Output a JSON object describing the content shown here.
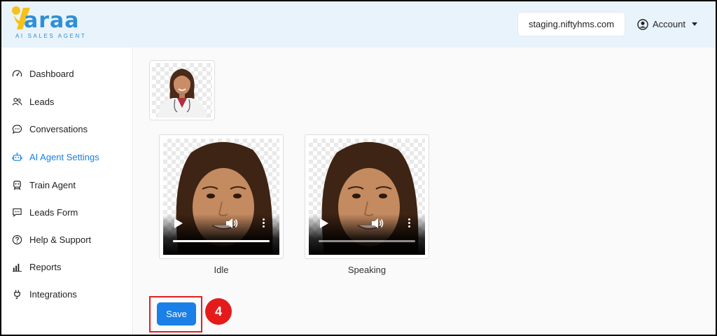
{
  "brand": {
    "name": "Yaraa",
    "word": "araa",
    "tagline": "AI SALES AGENT",
    "colors": {
      "blue": "#2e8fd6",
      "yellow": "#f6c21a"
    }
  },
  "header": {
    "domain": "staging.niftyhms.com",
    "account_label": "Account",
    "account_icon": "user-circle-icon"
  },
  "sidebar": {
    "items": [
      {
        "label": "Dashboard",
        "icon": "gauge-icon",
        "active": false
      },
      {
        "label": "Leads",
        "icon": "users-icon",
        "active": false
      },
      {
        "label": "Conversations",
        "icon": "chat-bubble-icon",
        "active": false
      },
      {
        "label": "AI Agent Settings",
        "icon": "robot-icon",
        "active": true
      },
      {
        "label": "Train Agent",
        "icon": "train-agent-icon",
        "active": false
      },
      {
        "label": "Leads Form",
        "icon": "form-chat-icon",
        "active": false
      },
      {
        "label": "Help & Support",
        "icon": "question-circle-icon",
        "active": false
      },
      {
        "label": "Reports",
        "icon": "bar-chart-icon",
        "active": false
      },
      {
        "label": "Integrations",
        "icon": "plug-icon",
        "active": false
      }
    ],
    "active_color": "#1a7fe6"
  },
  "main": {
    "videos": [
      {
        "label": "Idle",
        "progress": 1.0
      },
      {
        "label": "Speaking",
        "progress": 0.0
      }
    ],
    "save_label": "Save",
    "step_badge": "4"
  }
}
